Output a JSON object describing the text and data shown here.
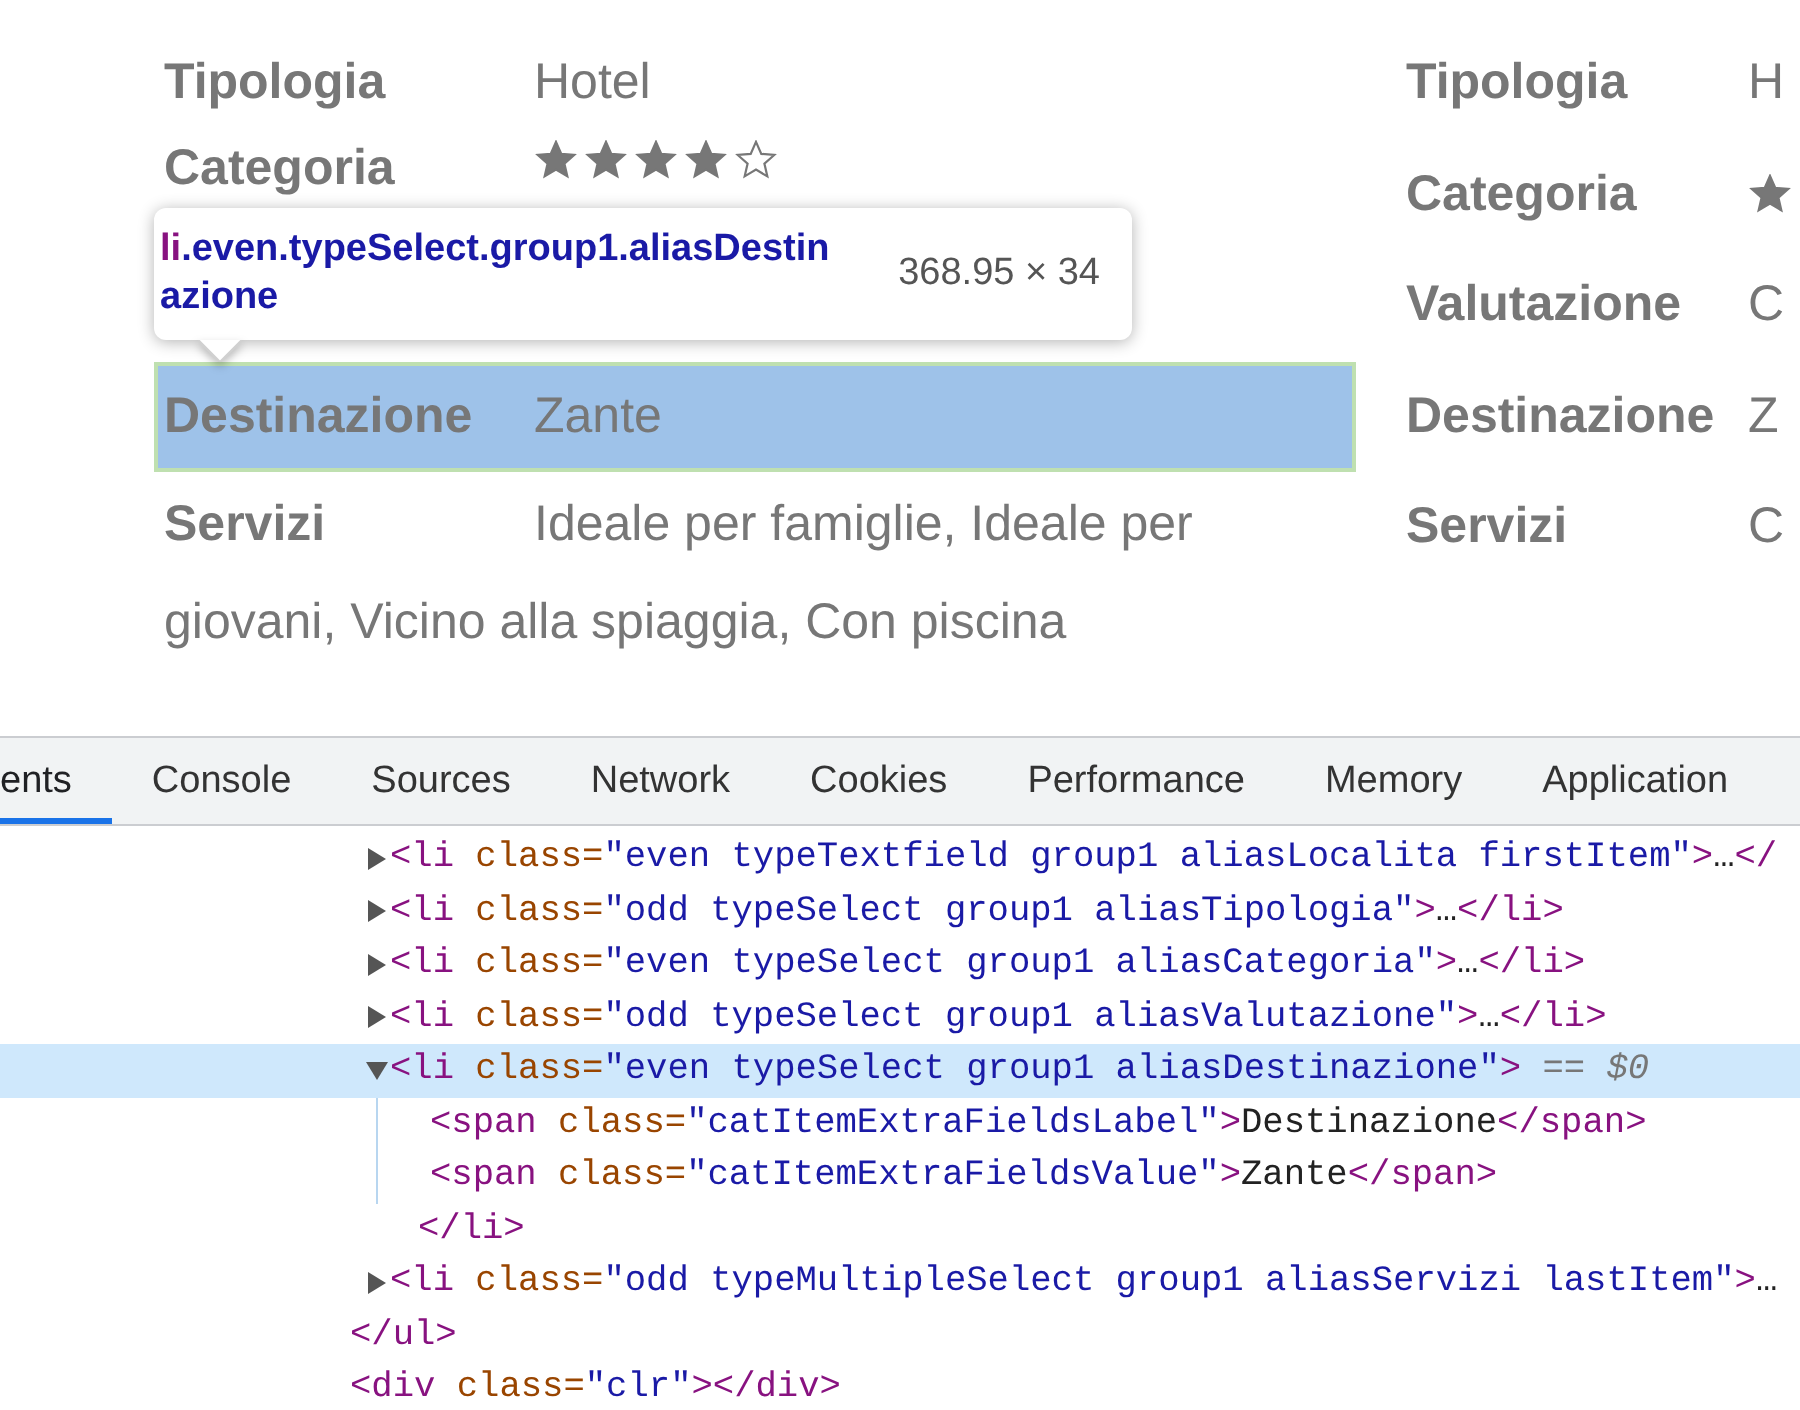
{
  "details": {
    "columns": [
      {
        "rows": [
          {
            "label": "Tipologia",
            "kind": "text",
            "value": "Hotel"
          },
          {
            "label": "Categoria",
            "kind": "stars",
            "stars": 4
          },
          {
            "label": "",
            "kind": "hidden"
          },
          {
            "label": "Destinazione",
            "kind": "text",
            "value": "Zante",
            "highlighted": true
          },
          {
            "label": "Servizi",
            "kind": "wrap",
            "value": "Ideale per famiglie, Ideale per giovani, Vicino alla spiaggia, Con piscina"
          }
        ]
      },
      {
        "rows": [
          {
            "label": "Tipologia",
            "kind": "text",
            "value": "H"
          },
          {
            "label": "Categoria",
            "kind": "star_icon"
          },
          {
            "label": "Valutazione",
            "kind": "text",
            "value": "C"
          },
          {
            "label": "Destinazione",
            "kind": "text",
            "value": "Z"
          },
          {
            "label": "Servizi",
            "kind": "text",
            "value": "C"
          }
        ]
      }
    ]
  },
  "inspect_tooltip": {
    "tag": "li",
    "classes": ".even.typeSelect.group1.aliasDestinazione",
    "size": "368.95 × 34"
  },
  "devtools": {
    "tabs": [
      {
        "label": "ents",
        "selected": true
      },
      {
        "label": "Console",
        "selected": false
      },
      {
        "label": "Sources",
        "selected": false
      },
      {
        "label": "Network",
        "selected": false
      },
      {
        "label": "Cookies",
        "selected": false
      },
      {
        "label": "Performance",
        "selected": false
      },
      {
        "label": "Memory",
        "selected": false
      },
      {
        "label": "Application",
        "selected": false
      }
    ],
    "elements_tree": [
      {
        "children": [
          {
            "expanded": false,
            "selected": false,
            "tokens": [
              {
                "kind": "tag",
                "text": "<li"
              },
              {
                "kind": "attr",
                "text": " class="
              },
              {
                "kind": "value",
                "text": "\"even typeTextfield group1 aliasLocalita firstItem\""
              },
              {
                "kind": "tag",
                "text": ">"
              },
              {
                "kind": "text",
                "text": "…"
              },
              {
                "kind": "tag",
                "text": "</"
              }
            ]
          },
          {
            "expanded": false,
            "selected": false,
            "tokens": [
              {
                "kind": "tag",
                "text": "<li"
              },
              {
                "kind": "attr",
                "text": " class="
              },
              {
                "kind": "value",
                "text": "\"odd typeSelect group1 aliasTipologia\""
              },
              {
                "kind": "tag",
                "text": ">"
              },
              {
                "kind": "text",
                "text": "…"
              },
              {
                "kind": "tag",
                "text": "</li>"
              }
            ]
          },
          {
            "expanded": false,
            "selected": false,
            "tokens": [
              {
                "kind": "tag",
                "text": "<li"
              },
              {
                "kind": "attr",
                "text": " class="
              },
              {
                "kind": "value",
                "text": "\"even typeSelect group1 aliasCategoria\""
              },
              {
                "kind": "tag",
                "text": ">"
              },
              {
                "kind": "text",
                "text": "…"
              },
              {
                "kind": "tag",
                "text": "</li>"
              }
            ]
          },
          {
            "expanded": false,
            "selected": false,
            "tokens": [
              {
                "kind": "tag",
                "text": "<li"
              },
              {
                "kind": "attr",
                "text": " class="
              },
              {
                "kind": "value",
                "text": "\"odd typeSelect group1 aliasValutazione\""
              },
              {
                "kind": "tag",
                "text": ">"
              },
              {
                "kind": "text",
                "text": "…"
              },
              {
                "kind": "tag",
                "text": "</li>"
              }
            ]
          },
          {
            "expanded": true,
            "selected": true,
            "tokens": [
              {
                "kind": "tag",
                "text": "<li"
              },
              {
                "kind": "attr",
                "text": " class="
              },
              {
                "kind": "value",
                "text": "\"even typeSelect group1 aliasDestinazione\""
              },
              {
                "kind": "tag",
                "text": ">"
              },
              {
                "kind": "meta",
                "text": " == $0"
              }
            ],
            "children": [
              {
                "tokens": [
                  {
                    "kind": "tag",
                    "text": "<span"
                  },
                  {
                    "kind": "attr",
                    "text": " class="
                  },
                  {
                    "kind": "value",
                    "text": "\"catItemExtraFieldsLabel\""
                  },
                  {
                    "kind": "tag",
                    "text": ">"
                  },
                  {
                    "kind": "text",
                    "text": "Destinazione"
                  },
                  {
                    "kind": "tag",
                    "text": "</span>"
                  }
                ]
              },
              {
                "tokens": [
                  {
                    "kind": "tag",
                    "text": "<span"
                  },
                  {
                    "kind": "attr",
                    "text": " class="
                  },
                  {
                    "kind": "value",
                    "text": "\"catItemExtraFieldsValue\""
                  },
                  {
                    "kind": "tag",
                    "text": ">"
                  },
                  {
                    "kind": "text",
                    "text": "Zante"
                  },
                  {
                    "kind": "tag",
                    "text": "</span>"
                  }
                ]
              }
            ],
            "close": [
              {
                "kind": "tag",
                "text": "</li>"
              }
            ]
          },
          {
            "expanded": false,
            "selected": false,
            "tokens": [
              {
                "kind": "tag",
                "text": "<li"
              },
              {
                "kind": "attr",
                "text": " class="
              },
              {
                "kind": "value",
                "text": "\"odd typeMultipleSelect group1 aliasServizi lastItem\""
              },
              {
                "kind": "tag",
                "text": ">"
              },
              {
                "kind": "text",
                "text": "…"
              }
            ]
          }
        ],
        "close": [
          {
            "kind": "tag",
            "text": "</ul>"
          }
        ]
      },
      {
        "tokens": [
          {
            "kind": "tag",
            "text": "<div"
          },
          {
            "kind": "attr",
            "text": " class="
          },
          {
            "kind": "value",
            "text": "\"clr\""
          },
          {
            "kind": "tag",
            "text": "></div>"
          }
        ]
      }
    ]
  }
}
